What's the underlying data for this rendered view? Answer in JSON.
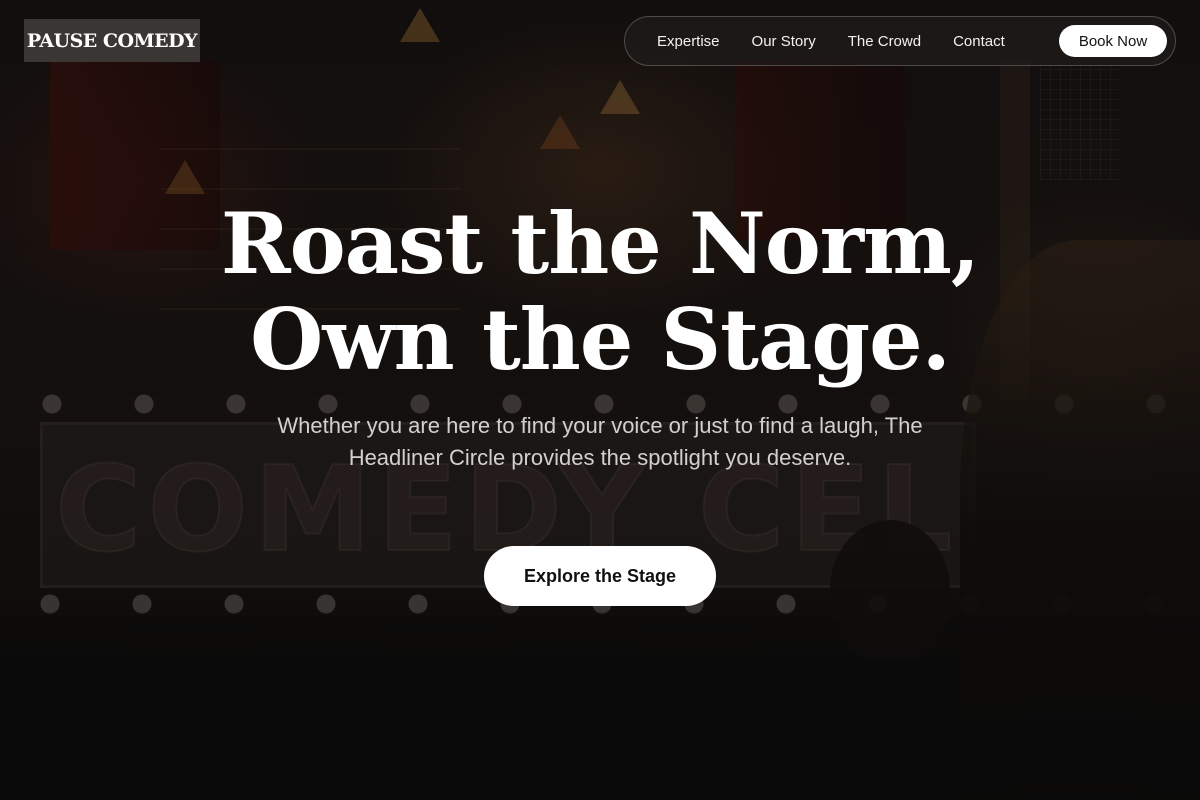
{
  "header": {
    "logo_text": "PAUSE COMEDY",
    "nav": [
      {
        "label": "Expertise"
      },
      {
        "label": "Our Story"
      },
      {
        "label": "The Crowd"
      },
      {
        "label": "Contact"
      }
    ],
    "book_label": "Book Now"
  },
  "hero": {
    "title_line1": "Roast the Norm,",
    "title_line2": "Own the Stage.",
    "subtitle": "Whether you are here to find your voice or just to find a laugh, The Headliner Circle provides the spotlight you deserve.",
    "cta_label": "Explore the Stage"
  },
  "background": {
    "sign_text": "COMEDY CELLAR",
    "description_colors": {
      "overlay": "#000000",
      "button_bg": "#ffffff",
      "logo_bg": "#3a3634"
    }
  }
}
